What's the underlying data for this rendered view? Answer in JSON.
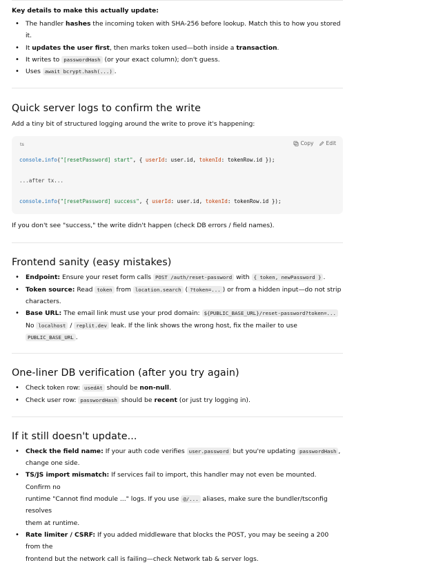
{
  "details": {
    "lead": "Key details to make this actually update:",
    "b1": {
      "t1": "The handler ",
      "b": "hashes",
      "t2": " the incoming token with SHA-256 before lookup. Match this to how you stored it."
    },
    "b2": {
      "t1": "It ",
      "b": "updates the user first",
      "t2": ", then marks token used—both inside a ",
      "b2": "transaction",
      "t3": "."
    },
    "b3": {
      "t1": "It writes to ",
      "code": "passwordHash",
      "t2": " (or your exact column); don't guess."
    },
    "b4": {
      "t1": "Uses ",
      "code": "await bcrypt.hash(...)",
      "t2": "."
    }
  },
  "logs": {
    "heading": "Quick server logs to confirm the write",
    "intro": "Add a tiny bit of structured logging around the write to prove it's happening:",
    "code": {
      "lang": "ts",
      "copy_label": "Copy",
      "edit_label": "Edit",
      "l1": {
        "obj": "console",
        "dot": ".",
        "fn": "info",
        "p1": "(",
        "str": "\"[resetPassword] start\"",
        "p2": ", { ",
        "k1": "userId",
        "p3": ": user.id, ",
        "k2": "tokenId",
        "p4": ": tokenRow.id });"
      },
      "l2": "...after tx...",
      "l3": {
        "obj": "console",
        "dot": ".",
        "fn": "info",
        "p1": "(",
        "str": "\"[resetPassword] success\"",
        "p2": ", { ",
        "k1": "userId",
        "p3": ": user.id, ",
        "k2": "tokenId",
        "p4": ": tokenRow.id });"
      }
    },
    "outro": "If you don't see \"success,\" the write didn't happen (check DB errors / field names)."
  },
  "frontend": {
    "heading": "Frontend sanity (easy mistakes)",
    "b1": {
      "b": "Endpoint:",
      "t1": " Ensure your reset form calls ",
      "c1": "POST /auth/reset-password",
      "t2": " with ",
      "c2": "{ token, newPassword }",
      "t3": "."
    },
    "b2": {
      "b": "Token source:",
      "t1": " Read ",
      "c1": "token",
      "t2": " from ",
      "c2": "location.search",
      "t3": " (",
      "c3": "?token=...",
      "t4": ") or from a hidden input—do not strip",
      "t5": "characters."
    },
    "b3": {
      "b": "Base URL:",
      "t1": " The email link must use your prod domain: ",
      "c1": "${PUBLIC_BASE_URL}/reset-password?token=...",
      "t2": "No ",
      "c2": "localhost",
      "t3": " / ",
      "c3": "replit.dev",
      "t4": " leak. If the link shows the wrong host, fix the mailer to use",
      "c4": "PUBLIC_BASE_URL",
      "t5": "."
    }
  },
  "db": {
    "heading": "One-liner DB verification (after you try again)",
    "b1": {
      "t1": "Check token row: ",
      "c1": "usedAt",
      "t2": " should be ",
      "b": "non-null",
      "t3": "."
    },
    "b2": {
      "t1": "Check user row: ",
      "c1": "passwordHash",
      "t2": " should be ",
      "b": "recent",
      "t3": " (or just try logging in)."
    }
  },
  "still": {
    "heading": "If it still doesn't update...",
    "b1": {
      "b": "Check the field name:",
      "t1": " If your auth code verifies ",
      "c1": "user.password",
      "t2": " but you're updating ",
      "c2": "passwordHash",
      "t3": ",",
      "t4": "change one side."
    },
    "b2": {
      "b": "TS/JS import mismatch:",
      "t1": " If services fail to import, this handler may not even be mounted. Confirm no",
      "t2": "runtime \"Cannot find module ...\" logs. If you use ",
      "c1": "@/...",
      "t3": " aliases, make sure the bundler/tsconfig resolves",
      "t4": "them at runtime."
    },
    "b3": {
      "b": "Rate limiter / CSRF:",
      "t1": " If you added middleware that blocks the POST, you may be seeing a 200 from the",
      "t2": "frontend but the network call is failing—check Network tab & server logs."
    }
  }
}
